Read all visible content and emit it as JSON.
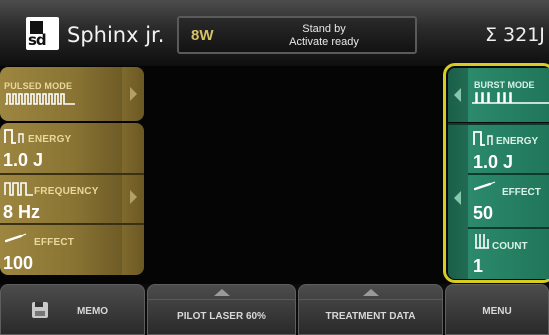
{
  "header": {
    "logo_text": "sd",
    "app_title": "Sphinx jr.",
    "power": "8W",
    "status_line1": "Stand by",
    "status_line2": "Activate ready",
    "sigma_counter": "Σ 321J"
  },
  "left_panel": {
    "mode_label": "PULSED MODE",
    "energy_label": "ENERGY",
    "energy_value": "1.0 J",
    "frequency_label": "FREQUENCY",
    "frequency_value": "8 Hz",
    "effect_label": "EFFECT",
    "effect_value": "100"
  },
  "right_panel": {
    "mode_label": "BURST MODE",
    "energy_label": "ENERGY",
    "energy_value": "1.0 J",
    "effect_label": "EFFECT",
    "effect_value": "50",
    "count_label": "COUNT",
    "count_value": "1"
  },
  "bottom_bar": {
    "memo_label": "MEMO",
    "pilot_label": "PILOT LASER 60%",
    "treatment_label": "TREATMENT DATA",
    "menu_label": "MENU"
  },
  "colors": {
    "gold_panel": "#9c8640",
    "green_panel": "#2c8a6c",
    "burst_highlight": "#d8cc22",
    "power_text": "#d7bf66"
  },
  "icons": {
    "pulsed_mode": "pulse-train-icon",
    "burst_mode": "burst-train-icon",
    "energy": "energy-pulse-icon",
    "frequency": "frequency-pulse-icon",
    "effect": "laser-effect-icon",
    "count": "count-bars-icon",
    "memo": "floppy-disk-icon"
  }
}
